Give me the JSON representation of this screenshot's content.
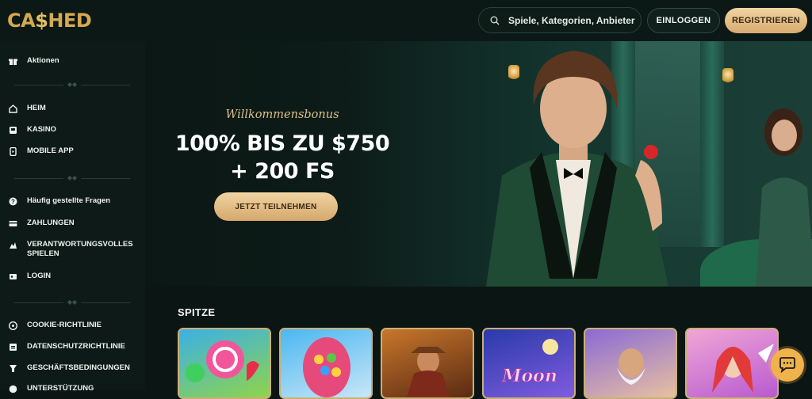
{
  "header": {
    "logo_text_a": "CA",
    "logo_text_b": "$",
    "logo_text_c": "HED",
    "search_placeholder": "Spiele, Kategorien, Anbieter",
    "login_label": "EINLOGGEN",
    "register_label": "REGISTRIEREN"
  },
  "sidebar": {
    "promo": {
      "label": "Aktionen",
      "icon": "gift-icon"
    },
    "group1": [
      {
        "label": "HEIM",
        "icon": "home-icon"
      },
      {
        "label": "KASINO",
        "icon": "slots-icon"
      },
      {
        "label": "MOBILE APP",
        "icon": "mobile-icon"
      }
    ],
    "group2": [
      {
        "label": "Häufig gestellte Fragen",
        "icon": "faq-icon"
      },
      {
        "label": "ZAHLUNGEN",
        "icon": "card-icon"
      },
      {
        "label_line1": "VERANTWORTUNGSVOLLES",
        "label_line2": "SPIELEN",
        "icon": "responsible-icon"
      },
      {
        "label": "LOGIN",
        "icon": "login-icon"
      }
    ],
    "group3": [
      {
        "label": "COOKIE-RICHTLINIE",
        "icon": "cookie-icon"
      },
      {
        "label": "DATENSCHUTZRICHTLINIE",
        "icon": "privacy-icon"
      },
      {
        "label": "GESCHÄFTSBEDINGUNGEN",
        "icon": "terms-icon"
      },
      {
        "label": "UNTERSTÜTZUNG",
        "icon": "support-icon"
      }
    ]
  },
  "hero": {
    "subtitle": "Willkommensbonus",
    "title_line1": "100% BIS ZU $750",
    "title_line2": "+ 200 FS",
    "cta_label": "JETZT TEILNEHMEN"
  },
  "games": {
    "section_title": "SPITZE",
    "tiles": [
      {
        "name": "candy-lollipop-game",
        "bg1": "#3bb0e6",
        "bg2": "#8fd44a"
      },
      {
        "name": "easter-egg-game",
        "bg1": "#4bb7f0",
        "bg2": "#c8e6f8"
      },
      {
        "name": "wild-west-game",
        "bg1": "#c8772c",
        "bg2": "#5a2a12"
      },
      {
        "name": "moon-princess-game",
        "bg1": "#2a3aa8",
        "bg2": "#7f5ce0"
      },
      {
        "name": "gates-of-olympus-game",
        "bg1": "#8a6ad6",
        "bg2": "#e8c0a0"
      },
      {
        "name": "starlight-princess-game",
        "bg1": "#f0a6d6",
        "bg2": "#b85ad0"
      }
    ]
  },
  "colors": {
    "accent_gold": "#d4a952",
    "button_gold": "#e8c48c",
    "background": "#0b1513",
    "chat": "#f0b24a"
  },
  "chat": {
    "icon": "chat-bubble-icon"
  }
}
